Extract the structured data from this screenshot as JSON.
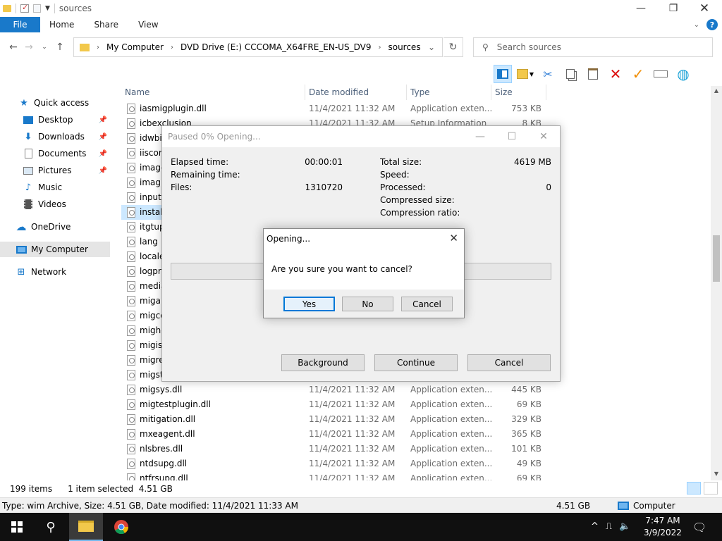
{
  "window": {
    "title": "sources"
  },
  "ribbon": {
    "tabs": [
      "File",
      "Home",
      "Share",
      "View"
    ]
  },
  "address": {
    "crumbs": [
      "My Computer",
      "DVD Drive (E:) CCCOMA_X64FRE_EN-US_DV9",
      "sources"
    ]
  },
  "search": {
    "placeholder": "Search sources"
  },
  "nav": {
    "items": [
      {
        "label": "Quick access",
        "icon": "star-icon"
      },
      {
        "label": "Desktop",
        "icon": "desktop-icon",
        "pinned": true
      },
      {
        "label": "Downloads",
        "icon": "download-icon",
        "pinned": true
      },
      {
        "label": "Documents",
        "icon": "document-icon",
        "pinned": true
      },
      {
        "label": "Pictures",
        "icon": "pictures-icon",
        "pinned": true
      },
      {
        "label": "Music",
        "icon": "music-icon"
      },
      {
        "label": "Videos",
        "icon": "videos-icon"
      },
      {
        "label": "OneDrive",
        "icon": "cloud-icon"
      },
      {
        "label": "My Computer",
        "icon": "computer-icon",
        "selected": true
      },
      {
        "label": "Network",
        "icon": "network-icon"
      }
    ]
  },
  "columns": {
    "name": "Name",
    "date": "Date modified",
    "type": "Type",
    "size": "Size"
  },
  "files": [
    {
      "name": "iasmigplugin.dll",
      "date": "11/4/2021 11:32 AM",
      "type": "Application exten...",
      "size": "753 KB"
    },
    {
      "name": "icbexclusion",
      "date": "11/4/2021 11:32 AM",
      "type": "Setup Information",
      "size": "8 KB"
    },
    {
      "name": "idwbi",
      "date": "",
      "type": "",
      "size": ""
    },
    {
      "name": "iiscom",
      "date": "",
      "type": "",
      "size": ""
    },
    {
      "name": "image",
      "date": "",
      "type": "",
      "size": ""
    },
    {
      "name": "imagi",
      "date": "",
      "type": "",
      "size": ""
    },
    {
      "name": "input.",
      "date": "",
      "type": "",
      "size": ""
    },
    {
      "name": "install",
      "date": "",
      "type": "",
      "size": "",
      "selected": true
    },
    {
      "name": "itgtup",
      "date": "",
      "type": "",
      "size": ""
    },
    {
      "name": "lang",
      "date": "",
      "type": "",
      "size": ""
    },
    {
      "name": "locale",
      "date": "",
      "type": "",
      "size": ""
    },
    {
      "name": "logpro",
      "date": "",
      "type": "",
      "size": ""
    },
    {
      "name": "media",
      "date": "",
      "type": "",
      "size": ""
    },
    {
      "name": "migap",
      "date": "",
      "type": "",
      "size": ""
    },
    {
      "name": "migco",
      "date": "",
      "type": "",
      "size": ""
    },
    {
      "name": "migho",
      "date": "",
      "type": "",
      "size": ""
    },
    {
      "name": "migis",
      "date": "",
      "type": "",
      "size": ""
    },
    {
      "name": "migre",
      "date": "",
      "type": "",
      "size": ""
    },
    {
      "name": "migst",
      "date": "",
      "type": "",
      "size": ""
    },
    {
      "name": "migsys.dll",
      "date": "11/4/2021 11:32 AM",
      "type": "Application exten...",
      "size": "445 KB"
    },
    {
      "name": "migtestplugin.dll",
      "date": "11/4/2021 11:32 AM",
      "type": "Application exten...",
      "size": "69 KB"
    },
    {
      "name": "mitigation.dll",
      "date": "11/4/2021 11:32 AM",
      "type": "Application exten...",
      "size": "329 KB"
    },
    {
      "name": "mxeagent.dll",
      "date": "11/4/2021 11:32 AM",
      "type": "Application exten...",
      "size": "365 KB"
    },
    {
      "name": "nlsbres.dll",
      "date": "11/4/2021 11:32 AM",
      "type": "Application exten...",
      "size": "101 KB"
    },
    {
      "name": "ntdsupg.dll",
      "date": "11/4/2021 11:32 AM",
      "type": "Application exten...",
      "size": "49 KB"
    },
    {
      "name": "ntfrsupg.dll",
      "date": "11/4/2021 11:32 AM",
      "type": "Application exten...",
      "size": "69 KB"
    }
  ],
  "status": {
    "items": "199 items",
    "selected": "1 item selected  4.51 GB"
  },
  "info": {
    "details": "Type: wim Archive, Size: 4.51 GB, Date modified: 11/4/2021 11:33 AM",
    "size": "4.51 GB",
    "location": "Computer"
  },
  "progress": {
    "title": "Paused 0% Opening...",
    "elapsed_label": "Elapsed time:",
    "elapsed_value": "00:00:01",
    "remaining_label": "Remaining time:",
    "remaining_value": "",
    "files_label": "Files:",
    "files_value": "1310720",
    "total_label": "Total size:",
    "total_value": "4619 MB",
    "speed_label": "Speed:",
    "speed_value": "",
    "processed_label": "Processed:",
    "processed_value": "0",
    "compressed_label": "Compressed size:",
    "compressed_value": "",
    "ratio_label": "Compression ratio:",
    "ratio_value": "",
    "percent": 0,
    "buttons": {
      "background": "Background",
      "continue": "Continue",
      "cancel": "Cancel"
    }
  },
  "confirm": {
    "title": "Opening...",
    "message": "Are you sure you want to cancel?",
    "yes": "Yes",
    "no": "No",
    "cancel": "Cancel"
  },
  "taskbar": {
    "time": "7:47 AM",
    "date": "3/9/2022"
  },
  "colors": {
    "accent": "#1979ca",
    "selection": "#cce8ff",
    "progress": "#06b025"
  }
}
